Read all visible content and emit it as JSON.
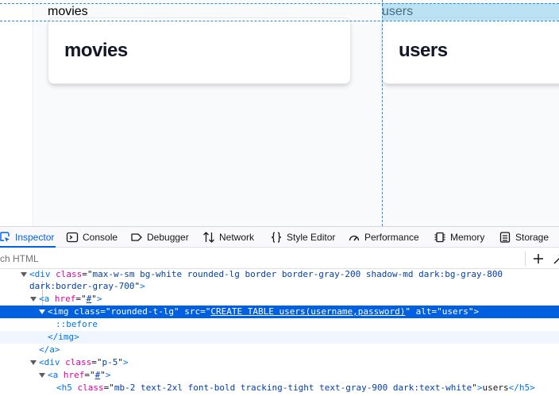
{
  "page": {
    "cards": [
      {
        "title": "movies",
        "alt": "movies"
      },
      {
        "title": "users",
        "alt": "users"
      }
    ]
  },
  "devtools": {
    "tabs": [
      {
        "label": "Inspector",
        "icon": "inspector-icon",
        "active": true
      },
      {
        "label": "Console",
        "icon": "console-icon"
      },
      {
        "label": "Debugger",
        "icon": "debugger-icon"
      },
      {
        "label": "Network",
        "icon": "network-icon"
      },
      {
        "label": "Style Editor",
        "icon": "style-editor-icon"
      },
      {
        "label": "Performance",
        "icon": "performance-icon"
      },
      {
        "label": "Memory",
        "icon": "memory-icon"
      },
      {
        "label": "Storage",
        "icon": "storage-icon"
      }
    ],
    "search_placeholder": "ch HTML",
    "markup": {
      "div1": {
        "tag": "div",
        "class_attr": "class",
        "class_value": "max-w-sm bg-white rounded-lg border border-gray-200 shadow-md dark:bg-gray-800",
        "class_value_cont": "dark:border-gray-700"
      },
      "a1": {
        "tag": "a",
        "href_attr": "href",
        "href_value": "#"
      },
      "img": {
        "tag": "img",
        "class_attr": "class",
        "class_value": "rounded-t-lg",
        "src_attr": "src",
        "src_value": "CREATE TABLE users(username,password)",
        "alt_attr": "alt",
        "alt_value": "users"
      },
      "before": "::before",
      "img_close": "img",
      "a_close": "a",
      "div2": {
        "tag": "div",
        "class_attr": "class",
        "class_value": "p-5"
      },
      "a2": {
        "tag": "a",
        "href_attr": "href",
        "href_value": "#"
      },
      "h5": {
        "tag": "h5",
        "class_attr": "class",
        "class_value": "mb-2 text-2xl font-bold tracking-tight text-gray-900 dark:text-white",
        "text": "users"
      }
    }
  }
}
